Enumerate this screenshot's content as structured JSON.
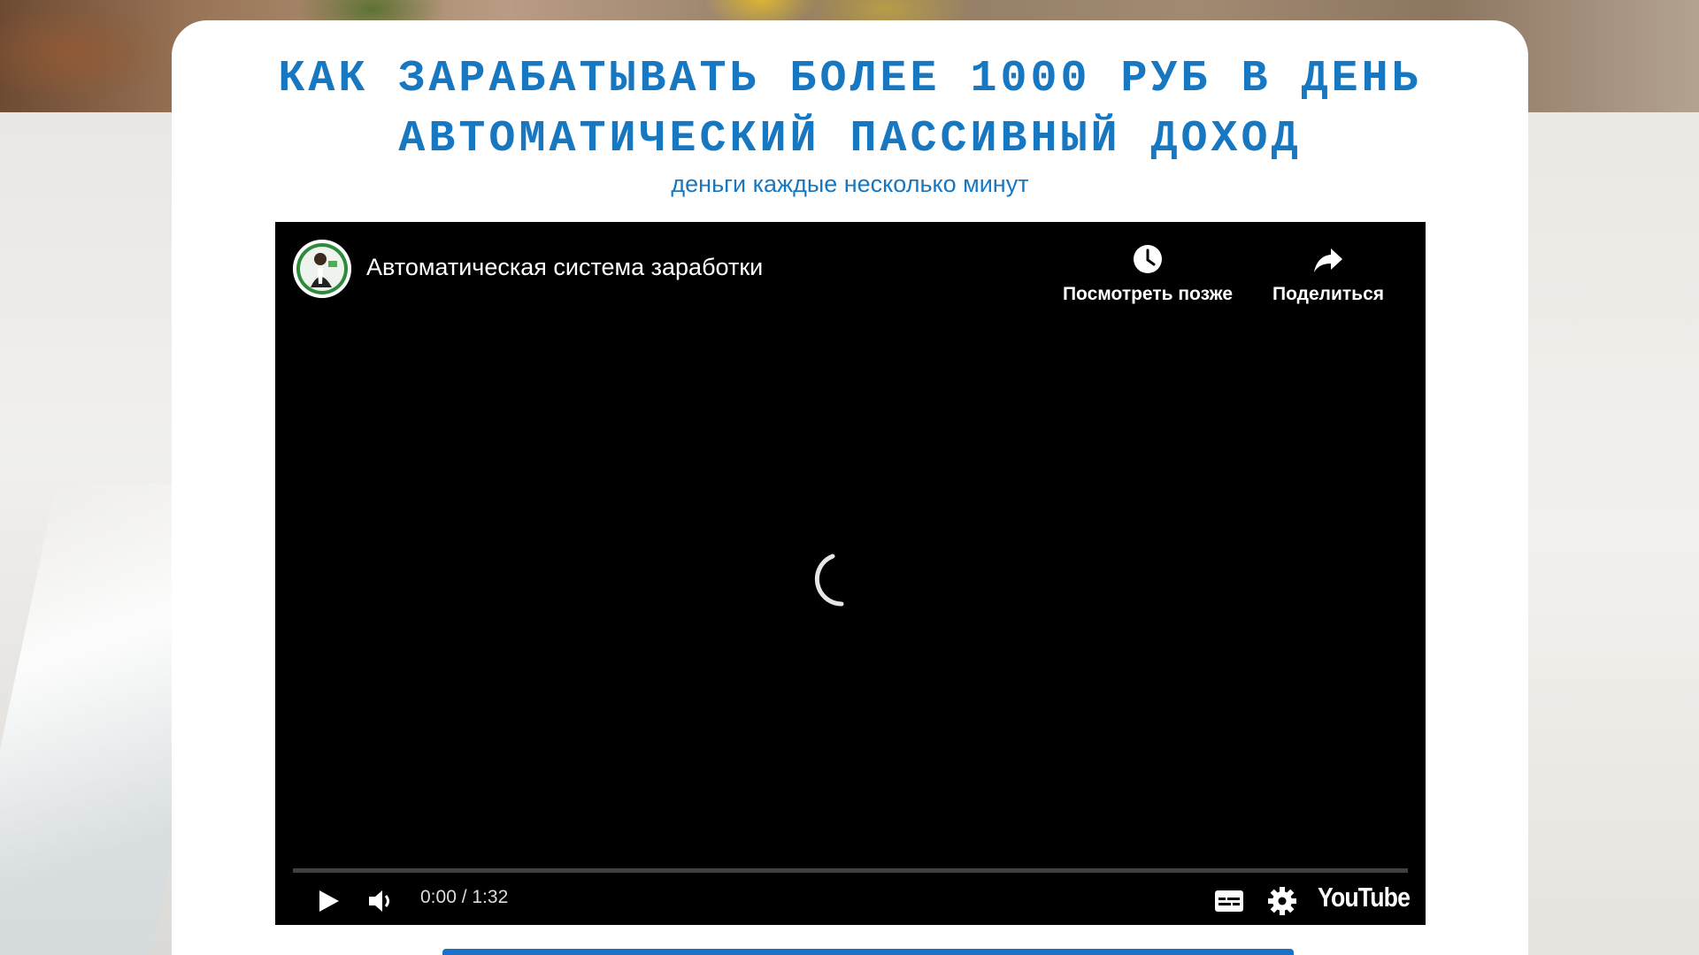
{
  "page": {
    "headline_line1": "КАК ЗАРАБАТЫВАТЬ БОЛЕЕ 1000 РУБ В ДЕНЬ",
    "headline_line2": "АВТОМАТИЧЕСКИЙ ПАССИВНЫЙ ДОХОД",
    "subtitle": "деньги каждые несколько минут",
    "accent_color": "#1777c1"
  },
  "video": {
    "title": "Автоматическая система заработки",
    "watch_later_label": "Посмотреть позже",
    "share_label": "Поделиться",
    "current_time": "0:00",
    "duration": "1:32",
    "time_display": "0:00 / 1:32",
    "progress": 0,
    "logo_text": "YouTube",
    "icons": {
      "avatar": "channel-avatar",
      "watch_later": "clock-icon",
      "share": "share-arrow-icon",
      "loading": "loading-spinner",
      "play": "play-icon",
      "volume": "volume-icon",
      "captions": "subtitles-icon",
      "settings": "gear-icon"
    }
  }
}
